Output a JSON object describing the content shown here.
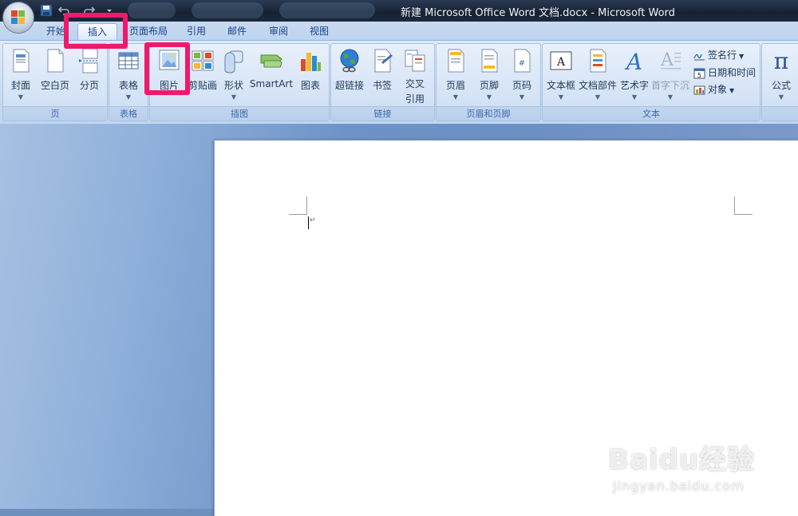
{
  "window": {
    "title": "新建 Microsoft Office Word 文档.docx - Microsoft Word"
  },
  "tabs": [
    {
      "id": "home",
      "label": "开始"
    },
    {
      "id": "insert",
      "label": "插入",
      "active": true
    },
    {
      "id": "layout",
      "label": "页面布局"
    },
    {
      "id": "references",
      "label": "引用"
    },
    {
      "id": "mailings",
      "label": "邮件"
    },
    {
      "id": "review",
      "label": "审阅"
    },
    {
      "id": "view",
      "label": "视图"
    }
  ],
  "ribbon": {
    "groups": {
      "pages": {
        "label": "页",
        "buttons": {
          "cover": "封面",
          "blank": "空白页",
          "pagebreak": "分页"
        }
      },
      "tables": {
        "label": "表格",
        "buttons": {
          "table": "表格"
        }
      },
      "illustrations": {
        "label": "插图",
        "buttons": {
          "picture": "图片",
          "clipart": "剪贴画",
          "shapes": "形状",
          "smartart": "SmartArt",
          "chart": "图表"
        }
      },
      "links": {
        "label": "链接",
        "buttons": {
          "hyperlink": "超链接",
          "bookmark": "书签",
          "crossref_1": "交叉",
          "crossref_2": "引用"
        }
      },
      "headerfooter": {
        "label": "页眉和页脚",
        "buttons": {
          "header": "页眉",
          "footer": "页脚",
          "pagenumber": "页码"
        }
      },
      "text": {
        "label": "文本",
        "buttons": {
          "textbox": "文本框",
          "quickparts": "文档部件",
          "wordart": "艺术字",
          "dropcap": "首字下沉",
          "signature": "签名行",
          "datetime": "日期和时间",
          "object": "对象"
        }
      },
      "symbols": {
        "buttons": {
          "equation": "公式"
        }
      }
    }
  },
  "watermark": {
    "logo": "Baidu经验",
    "url": "jingyan.baidu.com"
  },
  "colors": {
    "highlight": "#f0196a",
    "ribbon": "#dfeaf7",
    "accent": "#15428b"
  }
}
